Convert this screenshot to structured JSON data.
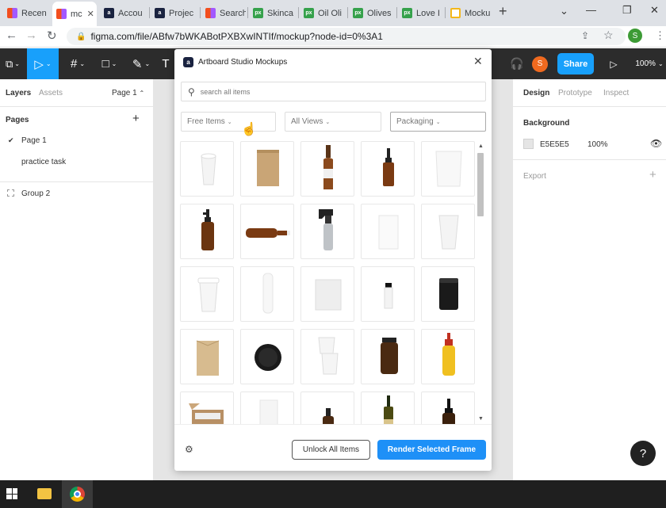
{
  "browser": {
    "tabs": [
      {
        "label": "Recen",
        "icon": "figma-icon",
        "active": false
      },
      {
        "label": "mc",
        "icon": "figma-icon",
        "active": true
      },
      {
        "label": "Accou",
        "icon": "artboard-icon",
        "active": false
      },
      {
        "label": "Projec",
        "icon": "artboard-icon",
        "active": false
      },
      {
        "label": "Search",
        "icon": "figma-icon",
        "active": false
      },
      {
        "label": "Skinca",
        "icon": "pixeden-icon",
        "active": false
      },
      {
        "label": "Oil Oli",
        "icon": "pixeden-icon",
        "active": false
      },
      {
        "label": "Olives",
        "icon": "pixeden-icon",
        "active": false
      },
      {
        "label": "Love I",
        "icon": "pixeden-icon",
        "active": false
      },
      {
        "label": "Mocku",
        "icon": "mockup-icon",
        "active": false
      }
    ],
    "url": "figma.com/file/ABfw7bWKABotPXBXwINTIf/mockup?node-id=0%3A1",
    "profile_initial": "S"
  },
  "figma": {
    "avatar_initial": "S",
    "share_label": "Share",
    "zoom": "100%",
    "left": {
      "tab_layers": "Layers",
      "tab_assets": "Assets",
      "page_selector": "Page 1",
      "pages_heading": "Pages",
      "pages": [
        "Page 1",
        "practice task"
      ],
      "layers": [
        "Group 2"
      ]
    },
    "right": {
      "tab_design": "Design",
      "tab_prototype": "Prototype",
      "tab_inspect": "Inspect",
      "background_heading": "Background",
      "bg_hex": "E5E5E5",
      "bg_opacity": "100%",
      "export_heading": "Export"
    }
  },
  "plugin": {
    "title": "Artboard Studio Mockups",
    "search_placeholder": "search all items",
    "filters": {
      "free": "Free Items",
      "views": "All Views",
      "category": "Packaging"
    },
    "unlock_label": "Unlock All Items",
    "render_label": "Render Selected Frame",
    "items": [
      "paper-cup",
      "kraft-pouch",
      "amber-beer-bottle",
      "dropper-bottle",
      "white-pouch",
      "pump-bottle",
      "lying-bottle",
      "spray-bottle",
      "white-box",
      "tall-paper-cup",
      "coffee-cup",
      "white-tube",
      "snack-bag",
      "small-vial",
      "black-tin",
      "kraft-bag",
      "black-lid-jar",
      "stacked-cups",
      "amber-jar",
      "mustard-bottle",
      "open-box",
      "white-sachet",
      "amber-bottle-short",
      "olive-oil-bottle",
      "amber-pump-bottle"
    ]
  },
  "colors": {
    "figma_blue": "#18a0fb",
    "toolbar": "#2c2c2c",
    "canvas": "#e5e5e5",
    "avatar": "#f06a1f"
  }
}
